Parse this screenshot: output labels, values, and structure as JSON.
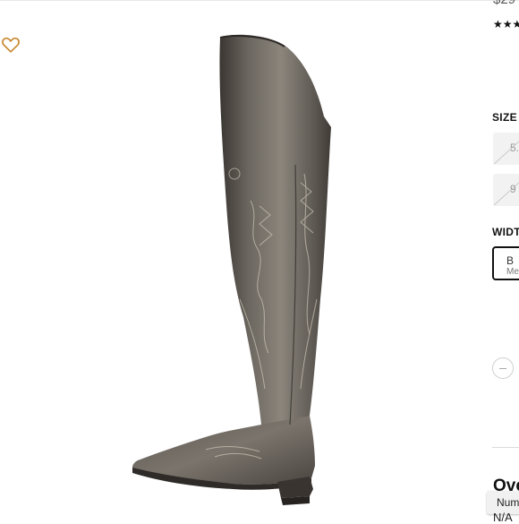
{
  "product": {
    "price": "$29",
    "rating_stars": "★★★",
    "favorite_icon": "heart-outline-icon"
  },
  "options": {
    "size_label": "SIZE",
    "sizes": [
      "5.",
      "9"
    ],
    "width_label": "WIDT",
    "width_option": {
      "code": "B",
      "name": "Me"
    }
  },
  "quantity": {
    "minus_icon": "minus-icon"
  },
  "overview": {
    "title": "Ove",
    "number_label": "Num",
    "number_value": "N/A"
  },
  "colors": {
    "accent": "#c8862e",
    "text": "#111111",
    "muted": "#9a9a9a"
  }
}
